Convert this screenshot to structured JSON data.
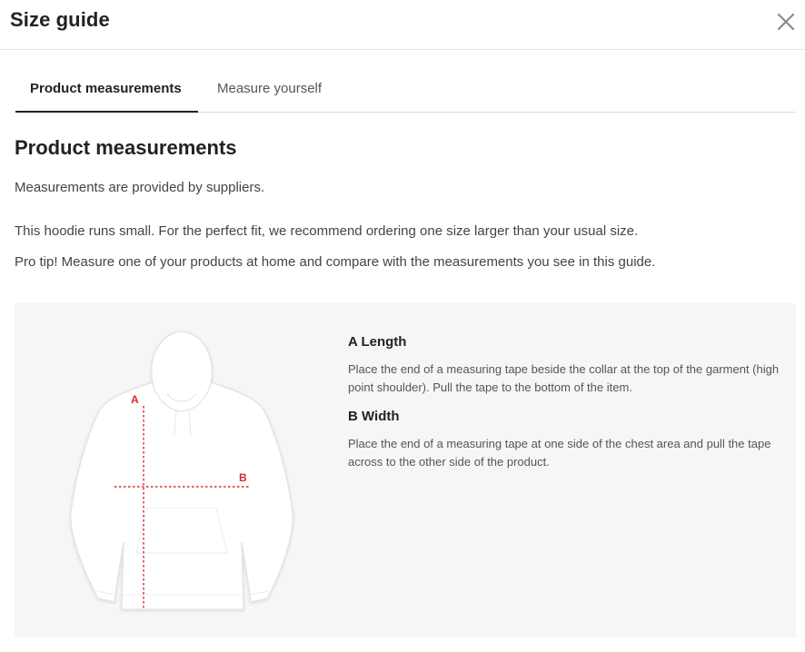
{
  "header": {
    "title": "Size guide"
  },
  "tabs": [
    {
      "label": "Product measurements",
      "active": true
    },
    {
      "label": "Measure yourself",
      "active": false
    }
  ],
  "content": {
    "title": "Product measurements",
    "paragraphs": [
      "Measurements are provided by suppliers.",
      "This hoodie runs small. For the perfect fit, we recommend ordering one size larger than your usual size.",
      "Pro tip! Measure one of your products at home and compare with the measurements you see in this guide."
    ]
  },
  "diagram": {
    "marker_a": "A",
    "marker_b": "B",
    "line_color": "#e0262b"
  },
  "measurements": [
    {
      "heading": "A Length",
      "text": "Place the end of a measuring tape beside the collar at the top of the garment (high point shoulder). Pull the tape to the bottom of the item."
    },
    {
      "heading": "B Width",
      "text": "Place the end of a measuring tape at one side of the chest area and pull the tape across to the other side of the product."
    }
  ],
  "icons": {
    "close": "close-icon"
  }
}
